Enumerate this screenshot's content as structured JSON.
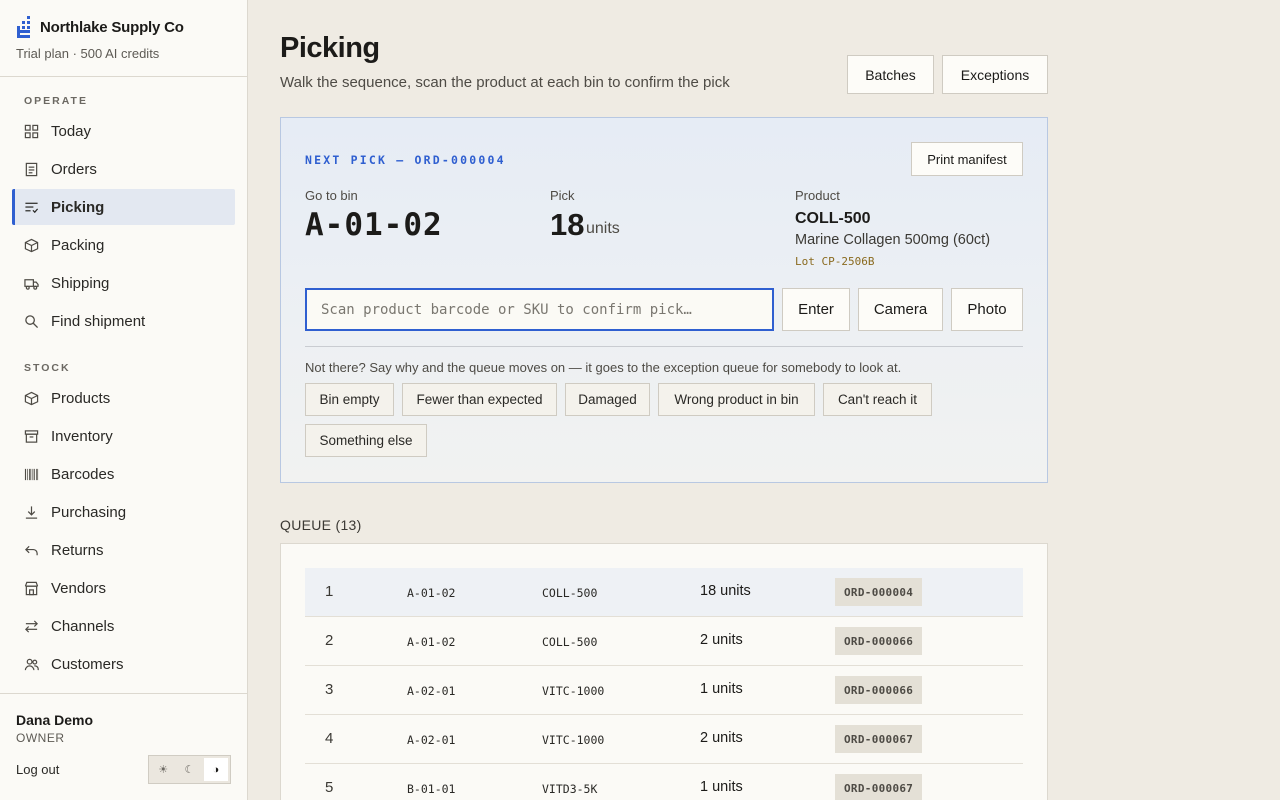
{
  "brand": {
    "name": "Northlake Supply Co",
    "plan": "Trial plan · 500 AI credits"
  },
  "sidebar": {
    "sections": [
      {
        "label": "OPERATE",
        "items": [
          {
            "label": "Today",
            "icon": "grid-icon"
          },
          {
            "label": "Orders",
            "icon": "document-icon"
          },
          {
            "label": "Picking",
            "icon": "list-check-icon",
            "active": true
          },
          {
            "label": "Packing",
            "icon": "box-icon"
          },
          {
            "label": "Shipping",
            "icon": "truck-icon"
          },
          {
            "label": "Find shipment",
            "icon": "search-icon"
          }
        ]
      },
      {
        "label": "STOCK",
        "items": [
          {
            "label": "Products",
            "icon": "cube-icon"
          },
          {
            "label": "Inventory",
            "icon": "archive-icon"
          },
          {
            "label": "Barcodes",
            "icon": "barcode-icon"
          },
          {
            "label": "Purchasing",
            "icon": "download-icon"
          },
          {
            "label": "Returns",
            "icon": "return-icon"
          },
          {
            "label": "Vendors",
            "icon": "store-icon"
          },
          {
            "label": "Channels",
            "icon": "swap-icon"
          },
          {
            "label": "Customers",
            "icon": "users-icon"
          }
        ]
      }
    ]
  },
  "user": {
    "name": "Dana Demo",
    "role": "OWNER",
    "logout": "Log out",
    "theme": {
      "light": "☀",
      "dark": "☾",
      "auto": "◑",
      "selected": "auto"
    }
  },
  "header": {
    "title": "Picking",
    "subtitle": "Walk the sequence, scan the product at each bin to confirm the pick",
    "batches_label": "Batches",
    "exceptions_label": "Exceptions"
  },
  "next_pick": {
    "label": "NEXT PICK — ORD-000004",
    "print_label": "Print manifest",
    "bin_label": "Go to bin",
    "bin": "A-01-02",
    "pick_label": "Pick",
    "qty": "18",
    "unit": "units",
    "product_label": "Product",
    "sku": "COLL-500",
    "product_name": "Marine Collagen 500mg (60ct)",
    "lot": "Lot CP-2506B",
    "scan_placeholder": "Scan product barcode or SKU to confirm pick…",
    "enter_label": "Enter",
    "camera_label": "Camera",
    "photo_label": "Photo",
    "exception_text": "Not there? Say why and the queue moves on — it goes to the exception queue for somebody to look at.",
    "reasons": [
      "Bin empty",
      "Fewer than expected",
      "Damaged",
      "Wrong product in bin",
      "Can't reach it",
      "Something else"
    ]
  },
  "queue": {
    "label": "QUEUE (13)",
    "rows": [
      {
        "num": "1",
        "bin": "A-01-02",
        "sku": "COLL-500",
        "qty": "18 units",
        "order": "ORD-000004"
      },
      {
        "num": "2",
        "bin": "A-01-02",
        "sku": "COLL-500",
        "qty": "2 units",
        "order": "ORD-000066"
      },
      {
        "num": "3",
        "bin": "A-02-01",
        "sku": "VITC-1000",
        "qty": "1 units",
        "order": "ORD-000066"
      },
      {
        "num": "4",
        "bin": "A-02-01",
        "sku": "VITC-1000",
        "qty": "2 units",
        "order": "ORD-000067"
      },
      {
        "num": "5",
        "bin": "B-01-01",
        "sku": "VITD3-5K",
        "qty": "1 units",
        "order": "ORD-000067"
      }
    ]
  },
  "colors": {
    "accent": "#2f5fd0",
    "background": "#efebe3",
    "sidebar": "#fbfaf6",
    "lot": "#8a6a1f"
  }
}
